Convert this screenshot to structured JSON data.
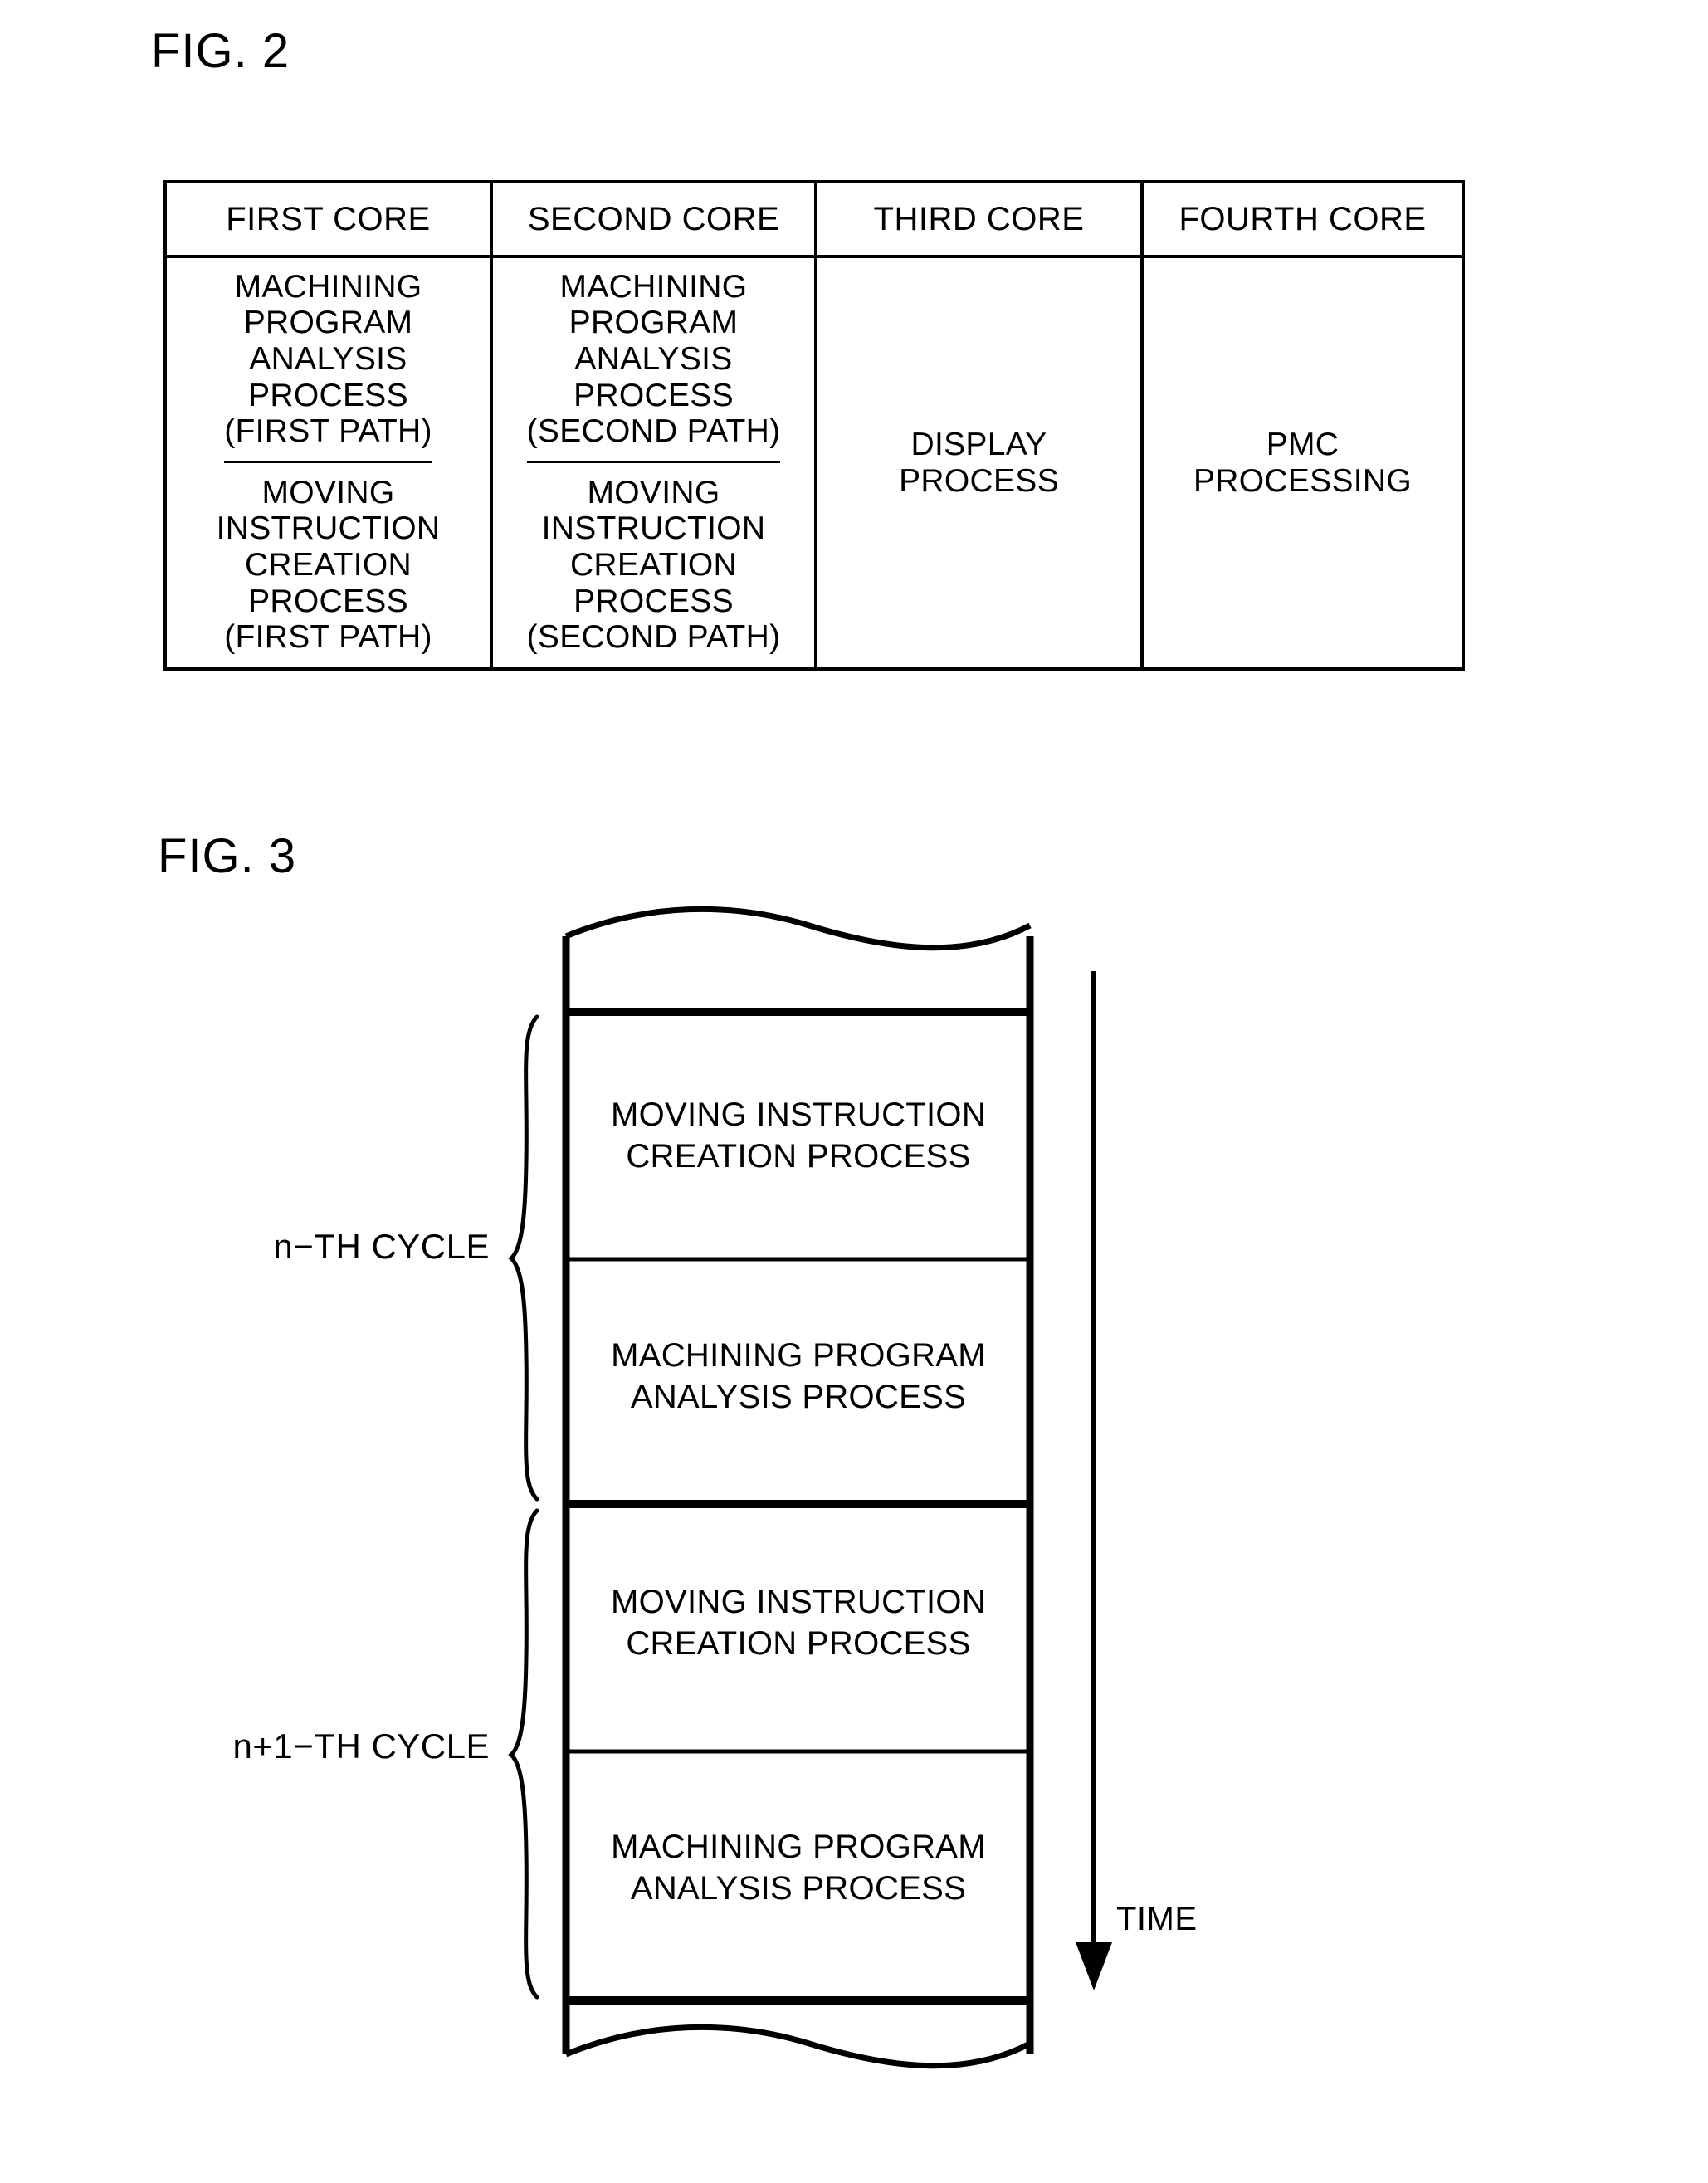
{
  "figures": {
    "fig2": {
      "label": "FIG. 2",
      "table": {
        "headers": [
          "FIRST CORE",
          "SECOND CORE",
          "THIRD CORE",
          "FOURTH CORE"
        ],
        "first_core": {
          "row1": "MACHINING\nPROGRAM\nANALYSIS\nPROCESS\n(FIRST PATH)",
          "row2": "MOVING\nINSTRUCTION\nCREATION\nPROCESS\n(FIRST PATH)"
        },
        "second_core": {
          "row1": "MACHINING\nPROGRAM\nANALYSIS\nPROCESS\n(SECOND PATH)",
          "row2": "MOVING\nINSTRUCTION\nCREATION\nPROCESS\n(SECOND PATH)"
        },
        "third_core": "DISPLAY\nPROCESS",
        "fourth_core": "PMC\nPROCESSING"
      }
    },
    "fig3": {
      "label": "FIG. 3",
      "blocks": [
        "MOVING INSTRUCTION\nCREATION PROCESS",
        "MACHINING PROGRAM\nANALYSIS PROCESS",
        "MOVING INSTRUCTION\nCREATION PROCESS",
        "MACHINING PROGRAM\nANALYSIS PROCESS"
      ],
      "cycle_labels": [
        "n−TH CYCLE",
        "n+1−TH CYCLE"
      ],
      "axis_label": "TIME"
    }
  },
  "colors": {
    "ink": "#000000",
    "paper": "#ffffff"
  }
}
